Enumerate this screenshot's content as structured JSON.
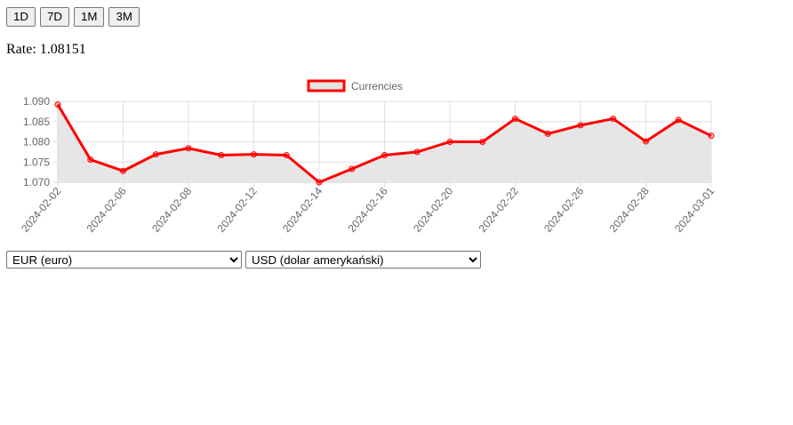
{
  "range_buttons": [
    "1D",
    "7D",
    "1M",
    "3M"
  ],
  "rate": {
    "label": "Rate:",
    "value": "1.08151"
  },
  "selects": {
    "from": {
      "selected": "EUR (euro)"
    },
    "to": {
      "selected": "USD (dolar amerykański)"
    }
  },
  "colors": {
    "line": "#ff0000",
    "fill": "#e3e3e3",
    "grid": "#e0e0e0",
    "tick_text": "#666666"
  },
  "chart_data": {
    "type": "line",
    "x": [
      "2024-02-02",
      "2024-02-05",
      "2024-02-06",
      "2024-02-07",
      "2024-02-08",
      "2024-02-09",
      "2024-02-12",
      "2024-02-13",
      "2024-02-14",
      "2024-02-15",
      "2024-02-16",
      "2024-02-19",
      "2024-02-20",
      "2024-02-21",
      "2024-02-22",
      "2024-02-23",
      "2024-02-26",
      "2024-02-27",
      "2024-02-28",
      "2024-02-29",
      "2024-03-01"
    ],
    "tick_labels": [
      "2024-02-02",
      "2024-02-06",
      "2024-02-08",
      "2024-02-12",
      "2024-02-14",
      "2024-02-16",
      "2024-02-20",
      "2024-02-22",
      "2024-02-26",
      "2024-02-28",
      "2024-03-01"
    ],
    "tick_indices": [
      0,
      2,
      4,
      6,
      8,
      10,
      12,
      14,
      16,
      18,
      20
    ],
    "series": [
      {
        "name": "Currencies",
        "values": [
          1.0892,
          1.0756,
          1.0728,
          1.0769,
          1.0784,
          1.0767,
          1.0769,
          1.0767,
          1.07,
          1.0733,
          1.0767,
          1.0775,
          1.08,
          1.08,
          1.0857,
          1.082,
          1.0841,
          1.0857,
          1.0801,
          1.0854,
          1.0815
        ]
      }
    ],
    "ylim": [
      1.07,
      1.09
    ],
    "yticks": [
      "1.070",
      "1.075",
      "1.080",
      "1.085",
      "1.090"
    ],
    "grid": true,
    "legend_position": "top"
  }
}
